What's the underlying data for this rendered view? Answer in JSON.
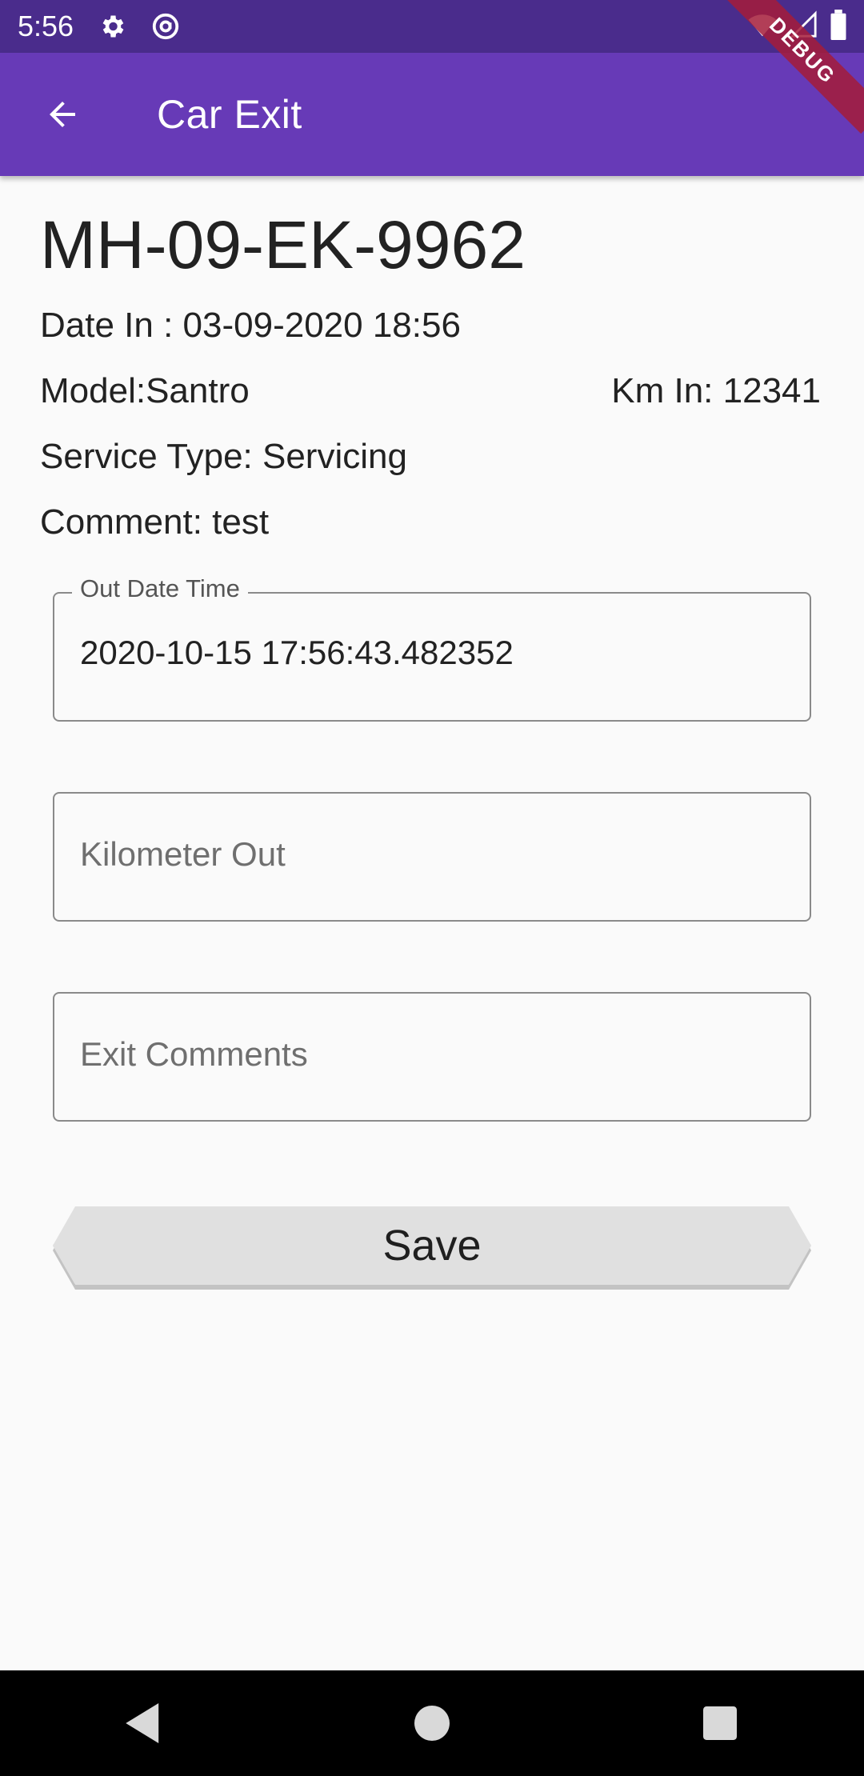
{
  "status_bar": {
    "time": "5:56",
    "icons": [
      "gear-icon",
      "at-sign-icon",
      "wifi-icon",
      "cellular-signal-icon",
      "battery-icon"
    ]
  },
  "app_bar": {
    "title": "Car Exit",
    "back_icon": "arrow-left-icon",
    "debug_banner": "DEBUG",
    "color": "#673ab7",
    "status_color": "#4a2c8c"
  },
  "vehicle": {
    "plate": "MH-09-EK-9962",
    "date_in": "Date In : 03-09-2020 18:56",
    "model": "Model:Santro",
    "km_in": "Km In: 12341",
    "service_type": "Service Type: Servicing",
    "comment": "Comment: test"
  },
  "form": {
    "out_date_time": {
      "label": "Out Date Time",
      "value": "2020-10-15 17:56:43.482352"
    },
    "kilometer_out": {
      "placeholder": "Kilometer Out"
    },
    "exit_comments": {
      "placeholder": "Exit Comments"
    },
    "save_label": "Save"
  },
  "nav_bar": {
    "buttons": [
      "back-triangle-icon",
      "home-circle-icon",
      "recents-square-icon"
    ]
  }
}
